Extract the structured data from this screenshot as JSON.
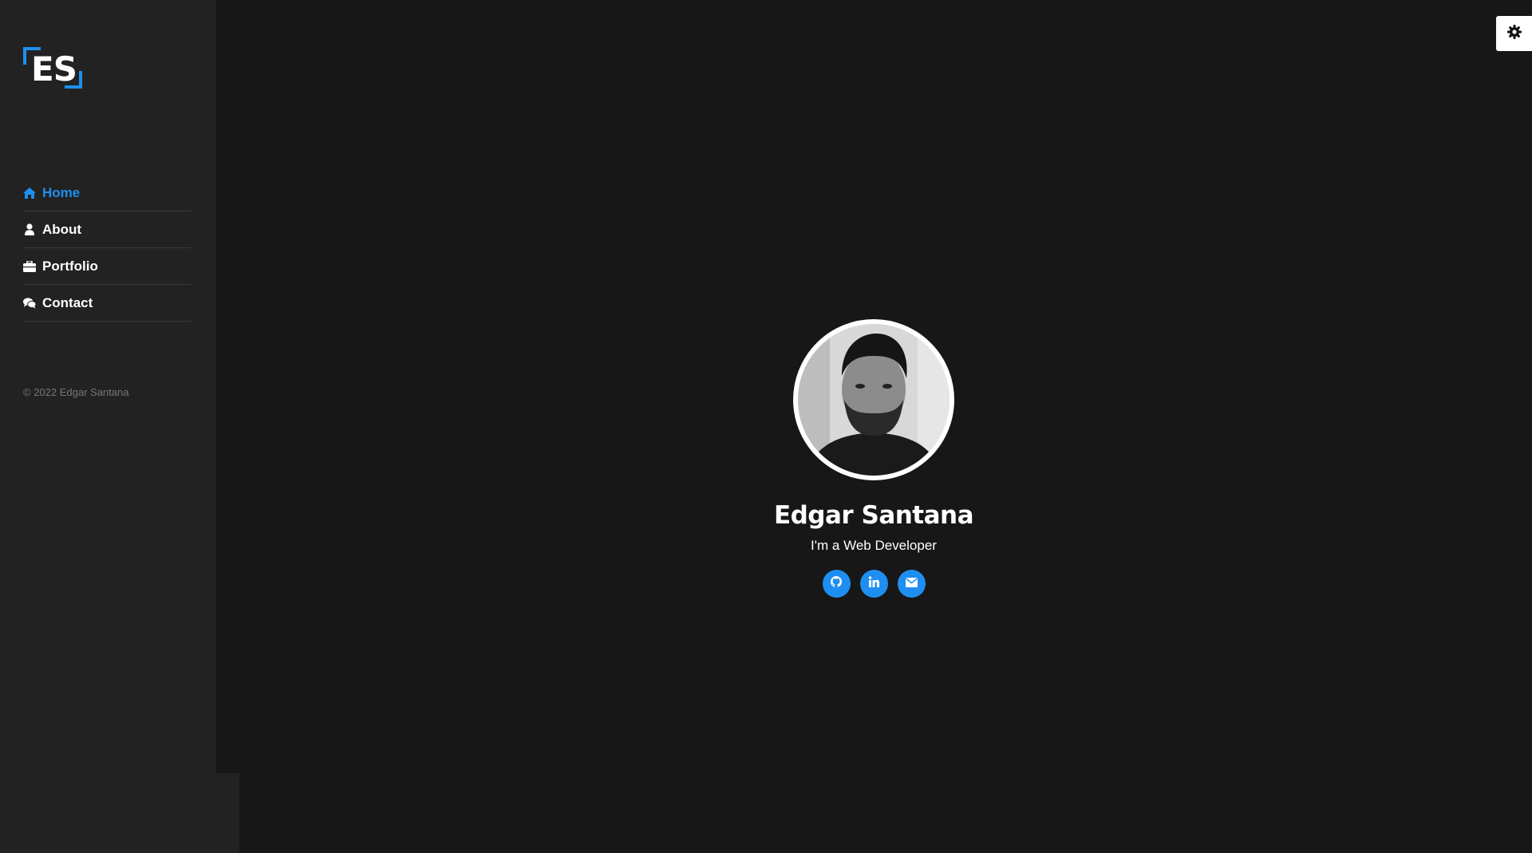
{
  "brand": {
    "logo_text": "ES",
    "accent_color": "#1e8ff0"
  },
  "sidebar": {
    "items": [
      {
        "label": "Home",
        "icon": "home-icon",
        "active": true
      },
      {
        "label": "About",
        "icon": "user-icon",
        "active": false
      },
      {
        "label": "Portfolio",
        "icon": "briefcase-icon",
        "active": false
      },
      {
        "label": "Contact",
        "icon": "comments-icon",
        "active": false
      }
    ],
    "copyright": "© 2022 Edgar Santana"
  },
  "hero": {
    "name": "Edgar Santana",
    "role": "I'm a Web Developer",
    "socials": [
      {
        "icon": "github-icon"
      },
      {
        "icon": "linkedin-icon"
      },
      {
        "icon": "envelope-icon"
      }
    ]
  },
  "settings": {
    "icon": "gear-icon"
  }
}
